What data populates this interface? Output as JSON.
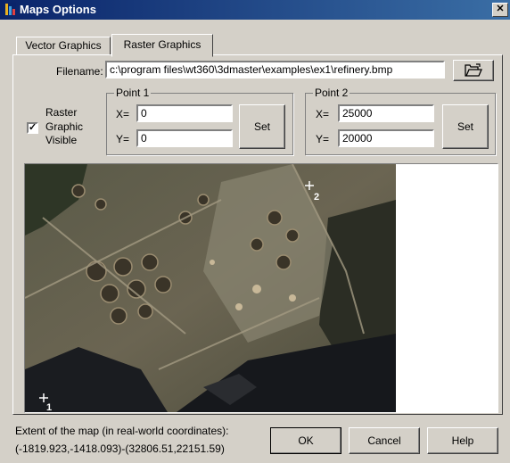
{
  "window": {
    "title": "Maps Options",
    "close_glyph": "✕"
  },
  "tabs": [
    {
      "label": "Vector Graphics"
    },
    {
      "label": "Raster Graphics"
    }
  ],
  "filename": {
    "label": "Filename:",
    "value": "c:\\program files\\wt360\\3dmaster\\examples\\ex1\\refinery.bmp",
    "browse_icon": "folder-open-icon"
  },
  "raster_visible": {
    "label_line1": "Raster",
    "label_line2": "Graphic",
    "label_line3": "Visible",
    "checked": true,
    "check_glyph": "✓"
  },
  "point1": {
    "title": "Point 1",
    "x_label": "X=",
    "x_value": "0",
    "y_label": "Y=",
    "y_value": "0",
    "set_label": "Set"
  },
  "point2": {
    "title": "Point 2",
    "x_label": "X=",
    "x_value": "25000",
    "y_label": "Y=",
    "y_value": "20000",
    "set_label": "Set"
  },
  "map": {
    "marker1": "1",
    "marker2": "2"
  },
  "extent": {
    "label": "Extent of the map (in real-world coordinates):",
    "value": "(-1819.923,-1418.093)-(32806.51,22151.59)"
  },
  "buttons": {
    "ok": "OK",
    "cancel": "Cancel",
    "help": "Help"
  },
  "colors": {
    "title_bar": "#0a246a",
    "dialog_bg": "#d4d0c8",
    "water": "#1a1c20"
  }
}
